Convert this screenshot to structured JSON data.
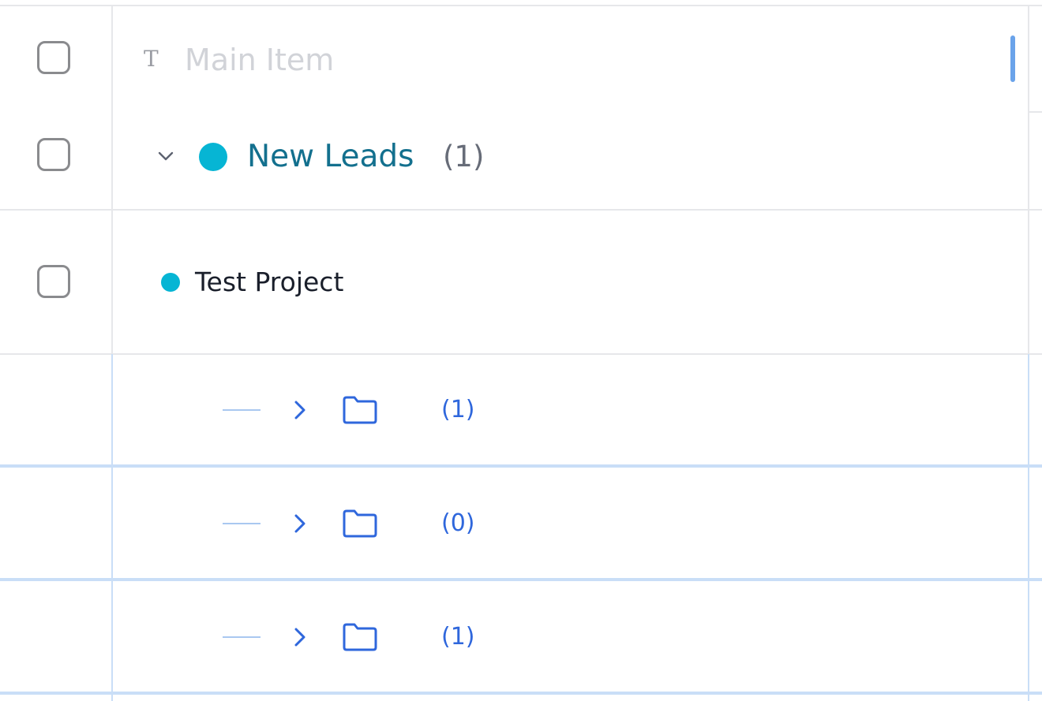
{
  "header_row": {
    "input_placeholder": "Main Item",
    "input_value": "",
    "text_icon": "text-type-icon",
    "checkbox_checked": false
  },
  "group": {
    "name": "New Leads",
    "count": "(1)",
    "color": "#06b5d4",
    "expanded": true,
    "checkbox_checked": false
  },
  "item": {
    "name": "Test Project",
    "color": "#06b5d4",
    "checkbox_checked": false
  },
  "subgroups": [
    {
      "count": "(1)",
      "expanded": false
    },
    {
      "count": "(0)",
      "expanded": false
    },
    {
      "count": "(1)",
      "expanded": false
    }
  ],
  "colors": {
    "accent_blue": "#2f67dc",
    "group_text": "#13708e",
    "grid_line": "#e6e7ea",
    "subgroup_line": "#c9def7"
  }
}
